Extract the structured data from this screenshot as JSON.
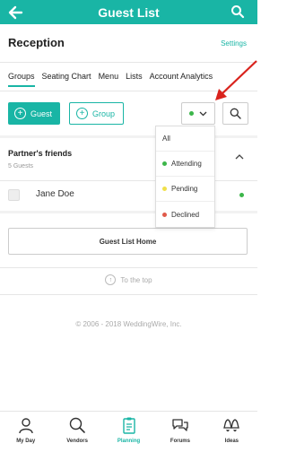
{
  "header": {
    "title": "Guest List",
    "back_icon": "back-arrow-icon",
    "search_icon": "search-icon",
    "color": "#19b5a5"
  },
  "event": {
    "name": "Reception",
    "settings_label": "Settings"
  },
  "tabs": [
    {
      "label": "Groups",
      "active": true
    },
    {
      "label": "Seating Chart",
      "active": false
    },
    {
      "label": "Menu",
      "active": false
    },
    {
      "label": "Lists",
      "active": false
    },
    {
      "label": "Account Analytics",
      "active": false
    }
  ],
  "actions": {
    "add_guest_label": "Guest",
    "add_group_label": "Group"
  },
  "filter": {
    "selected_color": "#3cb64a",
    "options": [
      {
        "label": "All",
        "color": ""
      },
      {
        "label": "Attending",
        "color": "#3cb64a"
      },
      {
        "label": "Pending",
        "color": "#f0e04a"
      },
      {
        "label": "Declined",
        "color": "#e05a4a"
      }
    ]
  },
  "group": {
    "name": "Partner's friends",
    "count": "5 Guests"
  },
  "guests": [
    {
      "name": "Jane Doe",
      "status_color": "#3cb64a"
    }
  ],
  "home_button": "Guest List Home",
  "to_top": "To the top",
  "footer": "© 2006 - 2018 WeddingWire, Inc.",
  "bottom_nav": [
    {
      "label": "My Day",
      "icon": "person-icon",
      "active": false
    },
    {
      "label": "Vendors",
      "icon": "search-icon",
      "active": false
    },
    {
      "label": "Planning",
      "icon": "clipboard-icon",
      "active": true
    },
    {
      "label": "Forums",
      "icon": "chat-bubbles-icon",
      "active": false
    },
    {
      "label": "Ideas",
      "icon": "bells-icon",
      "active": false
    }
  ]
}
